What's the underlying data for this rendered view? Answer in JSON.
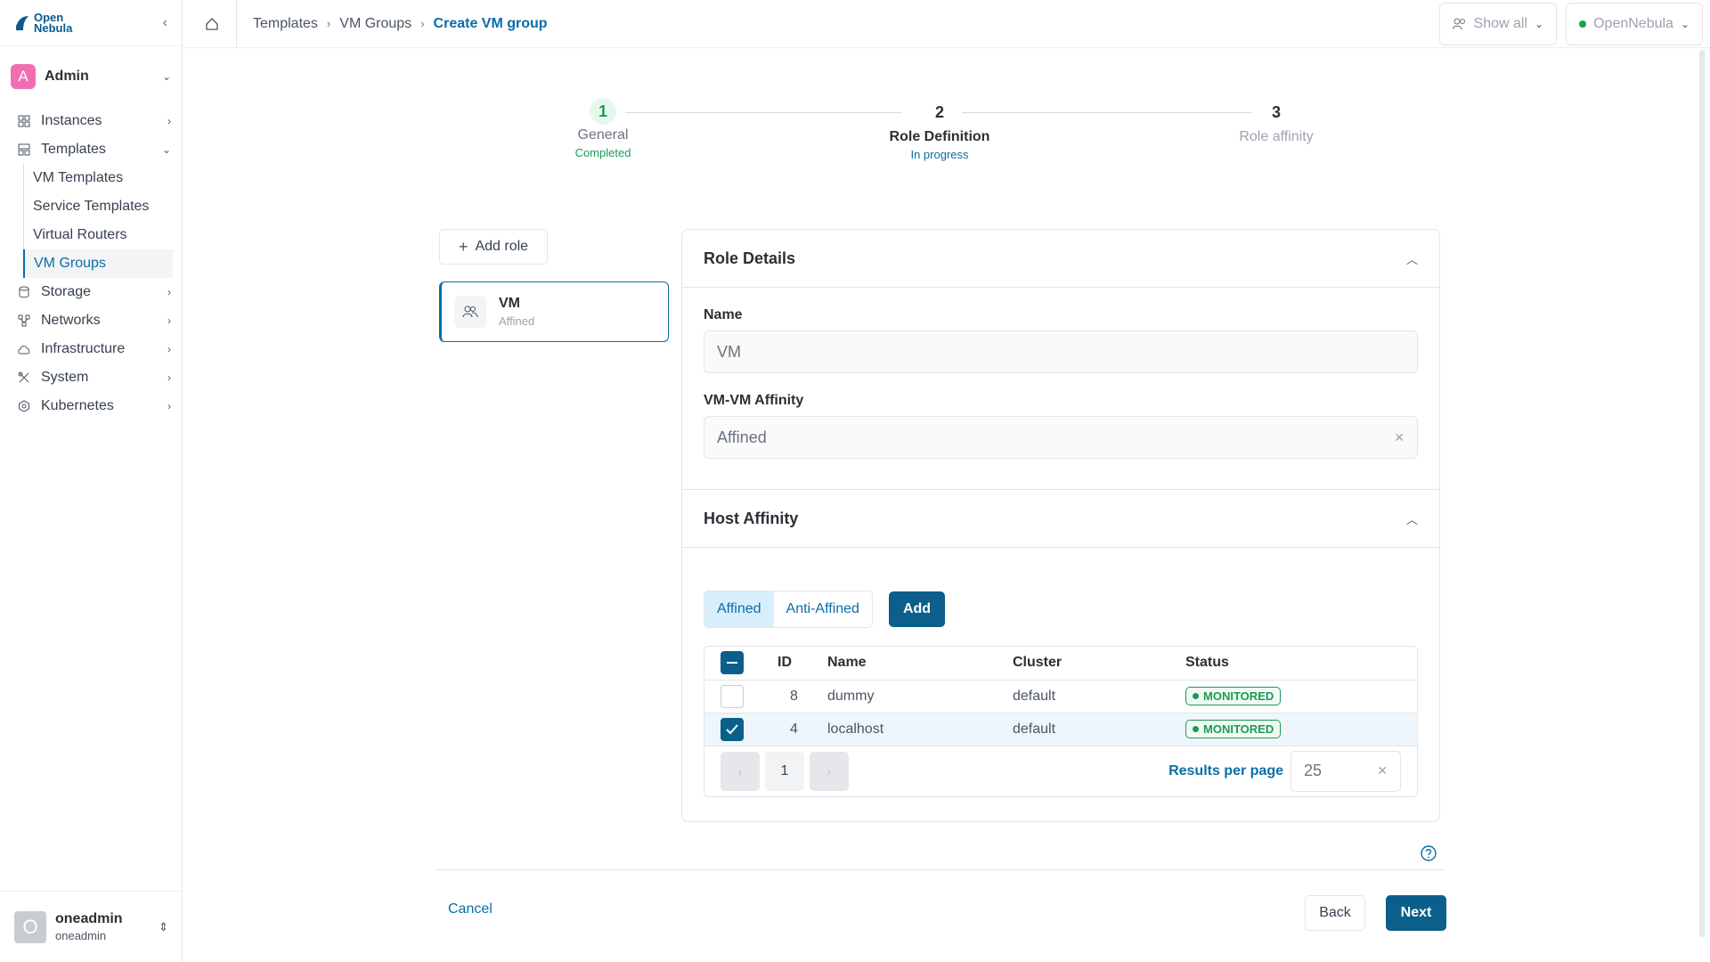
{
  "logo": {
    "line1": "Open",
    "line2": "Nebula"
  },
  "sidebar": {
    "group_avatar": "A",
    "group_label": "Admin",
    "items": [
      {
        "label": "Instances",
        "icon": "grid-icon"
      },
      {
        "label": "Templates",
        "icon": "template-icon"
      },
      {
        "label": "Storage",
        "icon": "database-icon"
      },
      {
        "label": "Networks",
        "icon": "network-icon"
      },
      {
        "label": "Infrastructure",
        "icon": "cloud-icon"
      },
      {
        "label": "System",
        "icon": "tools-icon"
      },
      {
        "label": "Kubernetes",
        "icon": "kubernetes-icon"
      }
    ],
    "templates_sub": [
      "VM Templates",
      "Service Templates",
      "Virtual Routers",
      "VM Groups"
    ]
  },
  "user": {
    "avatar": "O",
    "name": "oneadmin",
    "sub": "oneadmin"
  },
  "breadcrumb": [
    "Templates",
    "VM Groups",
    "Create VM group"
  ],
  "topbar": {
    "show_all": "Show all",
    "zone": "OpenNebula",
    "zone_status_color": "#16a34a"
  },
  "stepper": [
    {
      "num": "1",
      "title": "General",
      "status": "Completed"
    },
    {
      "num": "2",
      "title": "Role Definition",
      "status": "In progress"
    },
    {
      "num": "3",
      "title": "Role affinity",
      "status": ""
    }
  ],
  "roles": {
    "add_label": "Add role",
    "items": [
      {
        "name": "VM",
        "affinity": "Affined"
      }
    ]
  },
  "role_details": {
    "title": "Role Details",
    "name_label": "Name",
    "name_value": "VM",
    "affinity_label": "VM-VM Affinity",
    "affinity_value": "Affined"
  },
  "host_affinity": {
    "title": "Host Affinity",
    "tabs": [
      "Affined",
      "Anti-Affined"
    ],
    "add_label": "Add",
    "columns": [
      "ID",
      "Name",
      "Cluster",
      "Status"
    ],
    "rows": [
      {
        "id": "8",
        "name": "dummy",
        "cluster": "default",
        "status": "MONITORED",
        "checked": false
      },
      {
        "id": "4",
        "name": "localhost",
        "cluster": "default",
        "status": "MONITORED",
        "checked": true
      }
    ],
    "page": "1",
    "results_per_page_label": "Results per page",
    "results_per_page": "25"
  },
  "footer": {
    "cancel": "Cancel",
    "back": "Back",
    "next": "Next"
  },
  "colors": {
    "accent": "#0b5f8a",
    "link": "#0a6ea9",
    "success": "#1c9a57"
  }
}
